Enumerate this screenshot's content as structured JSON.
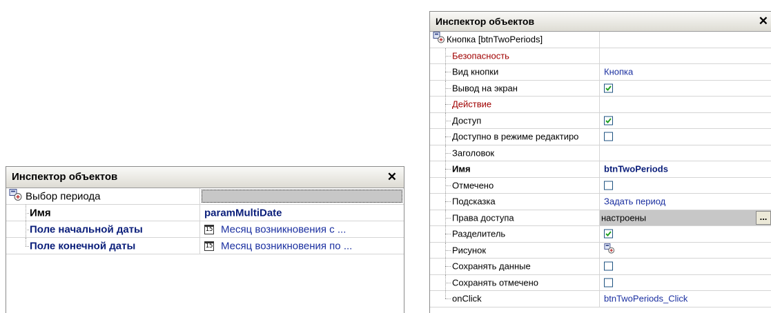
{
  "left_inspector": {
    "title": "Инспектор объектов",
    "root_label": "Выбор периода",
    "rows": [
      {
        "name": "Имя",
        "value": "paramMultiDate"
      },
      {
        "name": "Поле  начальной даты",
        "value": "Месяц возникновения с ..."
      },
      {
        "name": "Поле конечной даты",
        "value": "Месяц возникновения по ..."
      }
    ],
    "calendar_glyph": "15"
  },
  "right_inspector": {
    "title": "Инспектор объектов",
    "root_label": "Кнопка [btnTwoPeriods]",
    "rows": [
      {
        "name": "Безопасность",
        "kind": "category"
      },
      {
        "name": "Вид кнопки",
        "value": "Кнопка"
      },
      {
        "name": "Вывод на экран",
        "checked": true
      },
      {
        "name": "Действие",
        "kind": "category"
      },
      {
        "name": "Доступ",
        "checked": true
      },
      {
        "name": "Доступно в режиме редактиро",
        "checked": false
      },
      {
        "name": "Заголовок",
        "value": ""
      },
      {
        "name": "Имя",
        "value": "btnTwoPeriods"
      },
      {
        "name": "Отмечено",
        "checked": false
      },
      {
        "name": "Подсказка",
        "value": "Задать период"
      },
      {
        "name": "Права доступа",
        "value": "настроены",
        "ellipsis": "..."
      },
      {
        "name": "Разделитель",
        "checked": true
      },
      {
        "name": "Рисунок",
        "kind": "picture"
      },
      {
        "name": "Сохранять данные",
        "checked": false
      },
      {
        "name": "Сохранять отмечено",
        "checked": false
      },
      {
        "name": "onClick",
        "value": "btnTwoPeriods_Click"
      }
    ]
  },
  "colors": {
    "category": "#a00000",
    "bold_name": "#0a1e7a",
    "value_link": "#1a2fa0",
    "checkbox_border": "#1c5180",
    "check_mark": "#21a121"
  },
  "icons": {
    "close": "close-icon",
    "component": "component-icon",
    "calendar": "calendar-icon",
    "check": "checkmark-icon"
  }
}
